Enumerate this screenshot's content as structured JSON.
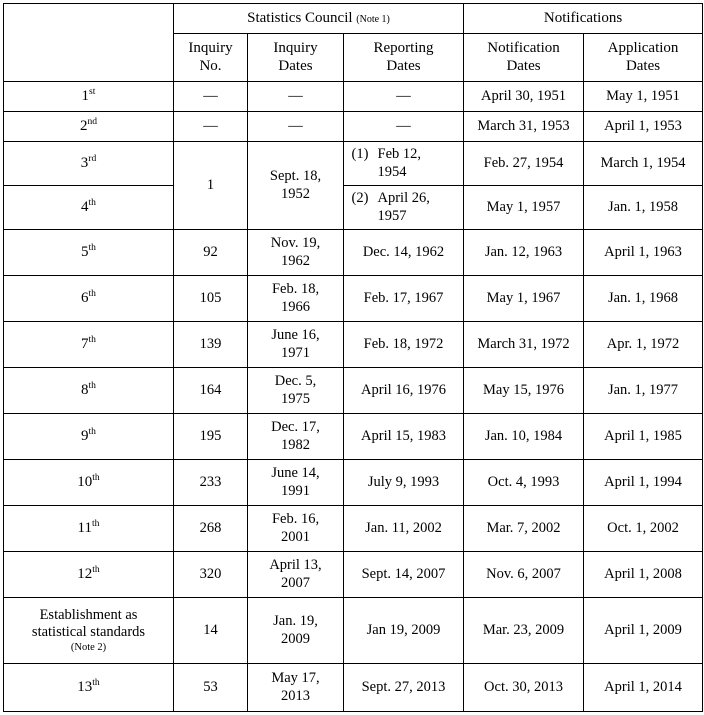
{
  "table": {
    "header": {
      "corner_label": "",
      "group_statistics_council": "Statistics Council",
      "group_statistics_council_note": "(Note 1)",
      "group_notifications": "Notifications",
      "columns": [
        {
          "label_line1": "",
          "label_line2": ""
        },
        {
          "label_line1": "Inquiry",
          "label_line2": "No."
        },
        {
          "label_line1": "Inquiry",
          "label_line2": "Dates"
        },
        {
          "label_line1": "Reporting",
          "label_line2": "Dates"
        },
        {
          "label_line1": "Notification",
          "label_line2": "Dates"
        },
        {
          "label_line1": "Application",
          "label_line2": "Dates"
        }
      ]
    },
    "rows": [
      {
        "ordinal_num": "1",
        "ordinal_suffix": "st",
        "inquiry_no": "—",
        "inquiry_dates": "—",
        "reporting_dates": "—",
        "notification_dates": "April 30, 1951",
        "application_dates": "May 1, 1951"
      },
      {
        "ordinal_num": "2",
        "ordinal_suffix": "nd",
        "inquiry_no": "—",
        "inquiry_dates": "—",
        "reporting_dates": "—",
        "notification_dates": "March 31, 1953",
        "application_dates": "April 1, 1953"
      },
      {
        "ordinal_num": "3",
        "ordinal_suffix": "rd",
        "inquiry_no": "1",
        "inquiry_dates": "Sept. 18,\n1952",
        "reporting_marker": "(1)",
        "reporting_dates": "Feb 12,\n1954",
        "notification_dates": "Feb. 27, 1954",
        "application_dates": "March 1, 1954"
      },
      {
        "ordinal_num": "4",
        "ordinal_suffix": "th",
        "reporting_marker": "(2)",
        "reporting_dates": "April 26,\n1957",
        "notification_dates": "May 1, 1957",
        "application_dates": "Jan. 1, 1958"
      },
      {
        "ordinal_num": "5",
        "ordinal_suffix": "th",
        "inquiry_no": "92",
        "inquiry_dates": "Nov. 19,\n1962",
        "reporting_dates": "Dec. 14, 1962",
        "notification_dates": "Jan. 12, 1963",
        "application_dates": "April 1, 1963"
      },
      {
        "ordinal_num": "6",
        "ordinal_suffix": "th",
        "inquiry_no": "105",
        "inquiry_dates": "Feb. 18,\n1966",
        "reporting_dates": "Feb. 17, 1967",
        "notification_dates": "May 1, 1967",
        "application_dates": "Jan. 1, 1968"
      },
      {
        "ordinal_num": "7",
        "ordinal_suffix": "th",
        "inquiry_no": "139",
        "inquiry_dates": "June 16,\n1971",
        "reporting_dates": "Feb. 18, 1972",
        "notification_dates": "March 31, 1972",
        "application_dates": "Apr. 1, 1972"
      },
      {
        "ordinal_num": "8",
        "ordinal_suffix": "th",
        "inquiry_no": "164",
        "inquiry_dates": "Dec. 5,\n1975",
        "reporting_dates": "April 16, 1976",
        "notification_dates": "May 15, 1976",
        "application_dates": "Jan. 1, 1977"
      },
      {
        "ordinal_num": "9",
        "ordinal_suffix": "th",
        "inquiry_no": "195",
        "inquiry_dates": "Dec. 17,\n1982",
        "reporting_dates": "April 15, 1983",
        "notification_dates": "Jan. 10, 1984",
        "application_dates": "April 1, 1985"
      },
      {
        "ordinal_num": "10",
        "ordinal_suffix": "th",
        "inquiry_no": "233",
        "inquiry_dates": "June 14,\n1991",
        "reporting_dates": "July 9, 1993",
        "notification_dates": "Oct. 4, 1993",
        "application_dates": "April 1, 1994"
      },
      {
        "ordinal_num": "11",
        "ordinal_suffix": "th",
        "inquiry_no": "268",
        "inquiry_dates": "Feb. 16,\n2001",
        "reporting_dates": "Jan. 11, 2002",
        "notification_dates": "Mar. 7, 2002",
        "application_dates": "Oct. 1, 2002"
      },
      {
        "ordinal_num": "12",
        "ordinal_suffix": "th",
        "inquiry_no": "320",
        "inquiry_dates": "April 13,\n2007",
        "reporting_dates": "Sept. 14, 2007",
        "notification_dates": "Nov. 6, 2007",
        "application_dates": "April 1, 2008"
      },
      {
        "label": "Establishment as\nstatistical standards",
        "label_note": "(Note 2)",
        "inquiry_no": "14",
        "inquiry_dates": "Jan. 19,\n2009",
        "reporting_dates": "Jan 19, 2009",
        "notification_dates": "Mar. 23, 2009",
        "application_dates": "April 1, 2009"
      },
      {
        "ordinal_num": "13",
        "ordinal_suffix": "th",
        "inquiry_no": "53",
        "inquiry_dates": "May 17,\n2013",
        "reporting_dates": "Sept. 27, 2013",
        "notification_dates": "Oct. 30, 2013",
        "application_dates": "April 1, 2014"
      }
    ]
  },
  "colors": {
    "border": "#000000",
    "text": "#000000",
    "background": "#ffffff"
  }
}
